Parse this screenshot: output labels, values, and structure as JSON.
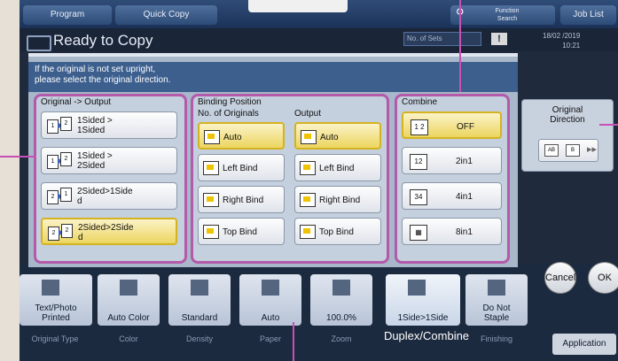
{
  "tabs": {
    "program": "Program",
    "quick_copy": "Quick Copy",
    "function_search": "Function Search",
    "job_list": "Job List"
  },
  "status": {
    "title": "Ready to Copy",
    "no_of_sets": "No. of Sets",
    "date": "18/02 /2019",
    "time": "10:21"
  },
  "dialog": {
    "message_line1": "If the original is not set upright,",
    "message_line2": "please select the original direction.",
    "original_output": {
      "title": "Original -> Output",
      "options": [
        {
          "l1": "1Sided >",
          "l2": "1Sided",
          "p1": "1",
          "p2": "2",
          "selected": false
        },
        {
          "l1": "1Sided >",
          "l2": "2Sided",
          "p1": "1",
          "p2": "2",
          "selected": false
        },
        {
          "l1": "2Sided>1Side",
          "l2": "d",
          "p1": "2",
          "p2": "1",
          "selected": false
        },
        {
          "l1": "2Sided>2Side",
          "l2": "d",
          "p1": "2",
          "p2": "2",
          "selected": true
        }
      ]
    },
    "binding": {
      "title": "Binding Position",
      "originals_label": "No. of Originals",
      "output_label": "Output",
      "originals": [
        "Auto",
        "Left Bind",
        "Right Bind",
        "Top Bind"
      ],
      "output": [
        "Auto",
        "Left Bind",
        "Right Bind",
        "Top Bind"
      ]
    },
    "combine": {
      "title": "Combine",
      "options": [
        "OFF",
        "2in1",
        "4in1",
        "8in1"
      ]
    },
    "direction": {
      "label1": "Original",
      "label2": "Direction",
      "icon1": "AB",
      "icon2": "B"
    }
  },
  "actions": {
    "cancel": "Cancel",
    "ok": "OK"
  },
  "bottom": {
    "buttons": [
      {
        "label1": "Text/Photo",
        "label2": "Printed",
        "caption": "Original Type"
      },
      {
        "label1": "Auto Color",
        "label2": "",
        "caption": "Color"
      },
      {
        "label1": "Standard",
        "label2": "",
        "caption": "Density"
      },
      {
        "label1": "Auto",
        "label2": "",
        "caption": "Paper"
      },
      {
        "label1": "100.0%",
        "label2": "",
        "caption": "Zoom"
      },
      {
        "label1": "1Side>1Side",
        "label2": "",
        "caption": "Duplex/Combine"
      },
      {
        "label1": "Do Not",
        "label2": "Staple",
        "caption": "Finishing"
      }
    ],
    "application": "Application"
  }
}
